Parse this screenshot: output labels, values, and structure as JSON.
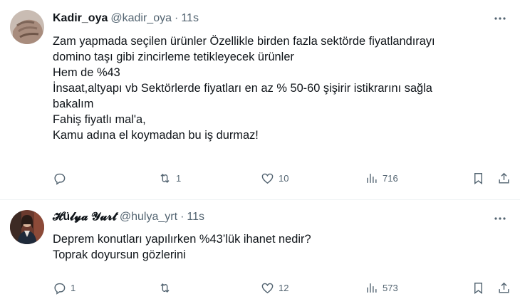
{
  "tweets": [
    {
      "display_name": "Kadir_oya",
      "handle": "@kadir_oya",
      "separator": "·",
      "time": "11s",
      "text_lines": [
        "Zam yapmada seçilen ürünler Özellikle birden fazla sektörde fiyatlandırayı",
        "domino taşı gibi zincirleme tetikleyecek ürünler",
        "Hem de %43",
        "İnsaat,altyapı vb Sektörlerde fiyatları en az % 50-60 şişirir istikrarını sağla",
        "bakalım",
        "Fahiş fiyatlı mal'a,",
        "Kamu adına el koymadan bu iş durmaz!"
      ],
      "replies": "",
      "retweets": "1",
      "likes": "10",
      "views": "716",
      "more_icon": "ellipsis-icon"
    },
    {
      "display_name": "𝓗ü𝓵𝔂𝓪 𝓨𝓾𝓻𝓽",
      "handle": "@hulya_yrt",
      "separator": "·",
      "time": "11s",
      "text_lines": [
        "Deprem konutları yapılırken %43’lük ihanet nedir?",
        "Toprak doyursun gözlerini"
      ],
      "replies": "1",
      "retweets": "",
      "likes": "12",
      "views": "573",
      "more_icon": "ellipsis-icon"
    }
  ],
  "colors": {
    "text": "#0f1419",
    "secondary": "#536471",
    "divider": "#eff3f4"
  }
}
